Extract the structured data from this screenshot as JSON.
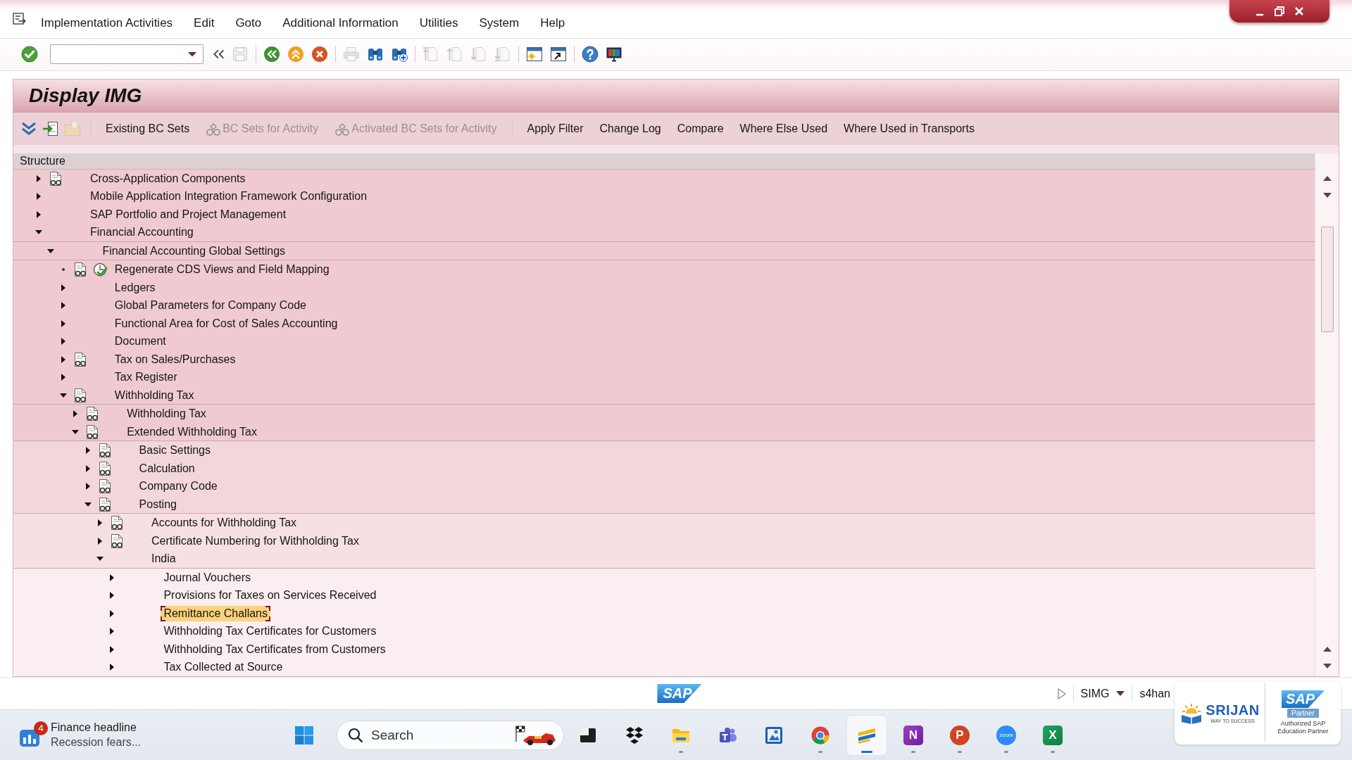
{
  "window": {
    "menu": [
      "Implementation Activities",
      "Edit",
      "Goto",
      "Additional Information",
      "Utilities",
      "System",
      "Help"
    ],
    "controls": [
      {
        "kind": "minimize"
      },
      {
        "kind": "restore"
      },
      {
        "kind": "close"
      }
    ]
  },
  "toolbar": [
    {
      "kind": "enter",
      "disabled": false
    },
    {
      "kind": "command_field",
      "disabled": false
    },
    {
      "kind": "collapse",
      "disabled": false
    },
    {
      "kind": "save",
      "disabled": true
    },
    {
      "kind": "separator"
    },
    {
      "kind": "back",
      "disabled": false
    },
    {
      "kind": "exit",
      "disabled": false
    },
    {
      "kind": "cancel",
      "disabled": false
    },
    {
      "kind": "separator"
    },
    {
      "kind": "print",
      "disabled": true
    },
    {
      "kind": "find",
      "disabled": false
    },
    {
      "kind": "find_next",
      "disabled": false
    },
    {
      "kind": "separator"
    },
    {
      "kind": "first_page",
      "disabled": true
    },
    {
      "kind": "previous_page",
      "disabled": true
    },
    {
      "kind": "next_page",
      "disabled": true
    },
    {
      "kind": "last_page",
      "disabled": true
    },
    {
      "kind": "separator"
    },
    {
      "kind": "new_session",
      "disabled": false
    },
    {
      "kind": "shortcut",
      "disabled": false
    },
    {
      "kind": "separator"
    },
    {
      "kind": "help",
      "disabled": false
    },
    {
      "kind": "customize",
      "disabled": false
    }
  ],
  "screen": {
    "title": "Display IMG",
    "app_toolbar": [
      {
        "kind": "expand",
        "disabled": false
      },
      {
        "kind": "import",
        "disabled": false
      },
      {
        "kind": "folder",
        "disabled": true
      },
      {
        "kind": "separator"
      },
      {
        "kind": "text",
        "label": "Existing BC Sets",
        "disabled": false
      },
      {
        "kind": "text_icon",
        "label": "BC Sets for Activity",
        "disabled": true
      },
      {
        "kind": "text_icon",
        "label": "Activated BC Sets for Activity",
        "disabled": true
      },
      {
        "kind": "separator"
      },
      {
        "kind": "text",
        "label": "Apply Filter",
        "disabled": false
      },
      {
        "kind": "text",
        "label": "Change Log",
        "disabled": false
      },
      {
        "kind": "text",
        "label": "Compare",
        "disabled": false
      },
      {
        "kind": "text",
        "label": "Where Else Used",
        "disabled": false
      },
      {
        "kind": "text",
        "label": "Where Used in Transports",
        "disabled": false
      }
    ]
  },
  "structure": {
    "header": "Structure",
    "nodes": [
      {
        "label": "Cross-Application Components",
        "kind": "folder",
        "expanded": false,
        "documentation": true,
        "executed": false,
        "selected": false
      },
      {
        "label": "Mobile Application Integration Framework Configuration",
        "kind": "folder",
        "expanded": false,
        "documentation": false,
        "executed": false,
        "selected": false
      },
      {
        "label": "SAP Portfolio and Project Management",
        "kind": "folder",
        "expanded": false,
        "documentation": false,
        "executed": false,
        "selected": false
      },
      {
        "label": "Financial Accounting",
        "kind": "folder",
        "expanded": true,
        "documentation": false,
        "executed": false,
        "selected": false,
        "children": [
          {
            "label": "Financial Accounting Global Settings",
            "kind": "folder",
            "expanded": true,
            "documentation": false,
            "executed": false,
            "selected": false,
            "children": [
              {
                "label": "Regenerate CDS Views and Field Mapping",
                "kind": "leaf",
                "documentation": true,
                "executed": true,
                "selected": false
              },
              {
                "label": "Ledgers",
                "kind": "folder",
                "expanded": false,
                "documentation": false,
                "executed": false,
                "selected": false
              },
              {
                "label": "Global Parameters for Company Code",
                "kind": "folder",
                "expanded": false,
                "documentation": false,
                "executed": false,
                "selected": false
              },
              {
                "label": "Functional Area for Cost of Sales Accounting",
                "kind": "folder",
                "expanded": false,
                "documentation": false,
                "executed": false,
                "selected": false
              },
              {
                "label": "Document",
                "kind": "folder",
                "expanded": false,
                "documentation": false,
                "executed": false,
                "selected": false
              },
              {
                "label": "Tax on Sales/Purchases",
                "kind": "folder",
                "expanded": false,
                "documentation": true,
                "executed": false,
                "selected": false
              },
              {
                "label": "Tax Register",
                "kind": "folder",
                "expanded": false,
                "documentation": false,
                "executed": false,
                "selected": false
              },
              {
                "label": "Withholding Tax",
                "kind": "folder",
                "expanded": true,
                "documentation": true,
                "executed": false,
                "selected": false,
                "children": [
                  {
                    "label": "Withholding Tax",
                    "kind": "folder",
                    "expanded": false,
                    "documentation": true,
                    "executed": false,
                    "selected": false
                  },
                  {
                    "label": "Extended Withholding Tax",
                    "kind": "folder",
                    "expanded": true,
                    "documentation": true,
                    "executed": false,
                    "selected": false,
                    "children": [
                      {
                        "label": "Basic Settings",
                        "kind": "folder",
                        "expanded": false,
                        "documentation": true,
                        "executed": false,
                        "selected": false
                      },
                      {
                        "label": "Calculation",
                        "kind": "folder",
                        "expanded": false,
                        "documentation": true,
                        "executed": false,
                        "selected": false
                      },
                      {
                        "label": "Company Code",
                        "kind": "folder",
                        "expanded": false,
                        "documentation": true,
                        "executed": false,
                        "selected": false
                      },
                      {
                        "label": "Posting",
                        "kind": "folder",
                        "expanded": true,
                        "documentation": true,
                        "executed": false,
                        "selected": false,
                        "children": [
                          {
                            "label": "Accounts for Withholding Tax",
                            "kind": "folder",
                            "expanded": false,
                            "documentation": true,
                            "executed": false,
                            "selected": false
                          },
                          {
                            "label": "Certificate Numbering for Withholding Tax",
                            "kind": "folder",
                            "expanded": false,
                            "documentation": true,
                            "executed": false,
                            "selected": false
                          },
                          {
                            "label": "India",
                            "kind": "folder",
                            "expanded": true,
                            "documentation": false,
                            "executed": false,
                            "selected": false,
                            "children": [
                              {
                                "label": "Journal Vouchers",
                                "kind": "folder",
                                "expanded": false,
                                "documentation": false,
                                "executed": false,
                                "selected": false
                              },
                              {
                                "label": "Provisions for Taxes on Services Received",
                                "kind": "folder",
                                "expanded": false,
                                "documentation": false,
                                "executed": false,
                                "selected": false
                              },
                              {
                                "label": "Remittance Challans",
                                "kind": "folder",
                                "expanded": false,
                                "documentation": false,
                                "executed": false,
                                "selected": true
                              },
                              {
                                "label": "Withholding Tax Certificates for Customers",
                                "kind": "folder",
                                "expanded": false,
                                "documentation": false,
                                "executed": false,
                                "selected": false
                              },
                              {
                                "label": "Withholding Tax Certificates from Customers",
                                "kind": "folder",
                                "expanded": false,
                                "documentation": false,
                                "executed": false,
                                "selected": false
                              },
                              {
                                "label": "Tax Collected at Source",
                                "kind": "folder",
                                "expanded": false,
                                "documentation": false,
                                "executed": false,
                                "selected": false
                              }
                            ]
                          }
                        ]
                      }
                    ]
                  }
                ]
              }
            ]
          }
        ]
      }
    ]
  },
  "status_bar": {
    "logo": "SAP",
    "transaction": "SIMG",
    "server": "s4han"
  },
  "taskbar": {
    "widget": {
      "badge": "4",
      "title": "Finance headline",
      "subtitle": "Recession fears..."
    },
    "search": {
      "placeholder": "Search"
    },
    "apps": [
      {
        "kind": "terminal",
        "running": false,
        "active": false
      },
      {
        "kind": "dropbox",
        "running": false,
        "active": false
      },
      {
        "kind": "explorer",
        "running": true,
        "active": false
      },
      {
        "kind": "teams",
        "running": false,
        "active": false
      },
      {
        "kind": "picture",
        "running": false,
        "active": false
      },
      {
        "kind": "browser",
        "running": true,
        "active": false
      },
      {
        "kind": "stripes",
        "running": true,
        "active": true
      },
      {
        "kind": "letter_purple",
        "label": "N",
        "running": true,
        "active": false
      },
      {
        "kind": "letter_orange",
        "label": "P",
        "running": true,
        "active": false
      },
      {
        "kind": "letter_circle",
        "label": "zoom",
        "running": true,
        "active": false
      },
      {
        "kind": "letter_green",
        "label": "X",
        "running": true,
        "active": false
      }
    ]
  },
  "brand_overlay": {
    "school": {
      "name": "SRIJAN",
      "tagline": "WAY TO SUCCESS"
    },
    "partner": {
      "logo": "SAP",
      "label": "Partner",
      "caption": "Authorized SAP Education Partner"
    }
  }
}
